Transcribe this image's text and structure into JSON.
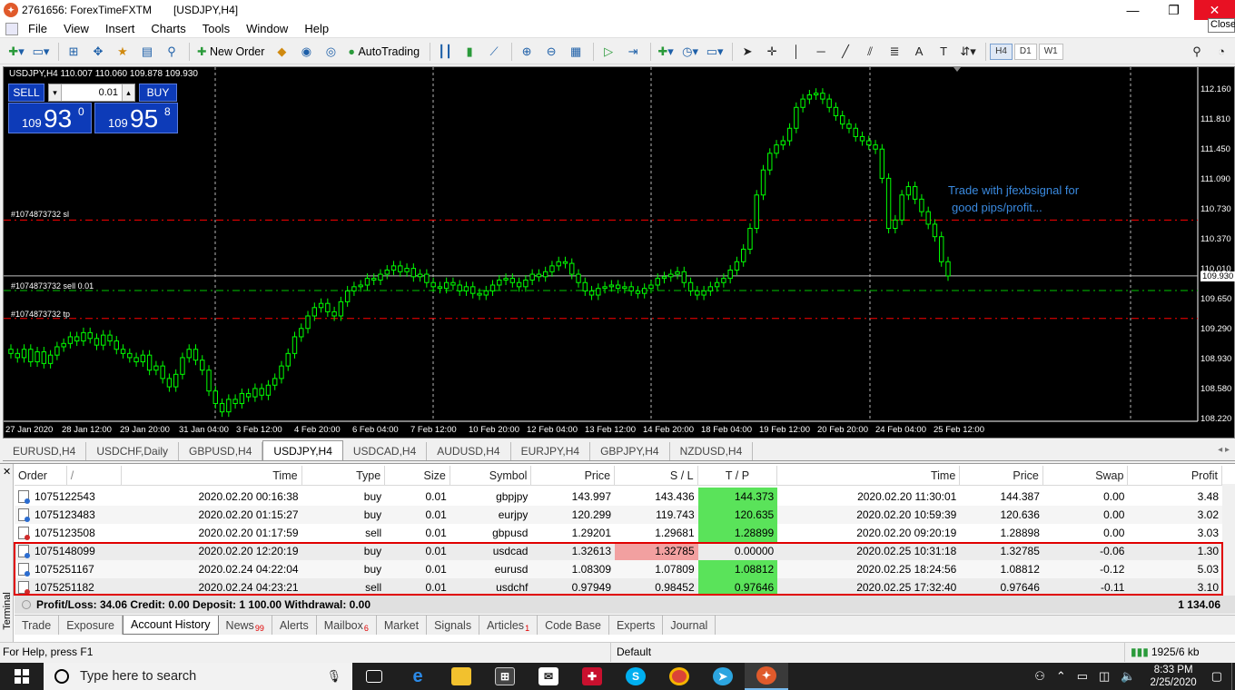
{
  "window": {
    "account": "2761656: ForexTimeFXTM",
    "doc": "[USDJPY,H4]"
  },
  "tooltip": "Close",
  "menu": [
    "File",
    "View",
    "Insert",
    "Charts",
    "Tools",
    "Window",
    "Help"
  ],
  "toolbar": {
    "new_order": "New Order",
    "autotrading": "AutoTrading",
    "timeframes": [
      "H4",
      "D1",
      "W1"
    ]
  },
  "chart": {
    "header": "USDJPY,H4  110.007 110.060 109.878 109.930",
    "oneclick": {
      "sell": "SELL",
      "buy": "BUY",
      "lot": "0.01",
      "sell_small": "109",
      "sell_big": "93",
      "sell_sup": "0",
      "buy_small": "109",
      "buy_big": "95",
      "buy_sup": "8"
    },
    "price_labels": [
      "112.160",
      "111.810",
      "111.450",
      "111.090",
      "110.730",
      "110.370",
      "110.010",
      "109.930",
      "109.650",
      "109.290",
      "108.930",
      "108.580",
      "108.220"
    ],
    "date_labels": [
      "27 Jan 2020",
      "28 Jan 12:00",
      "29 Jan 20:00",
      "31 Jan 04:00",
      "3 Feb 12:00",
      "4 Feb 20:00",
      "6 Feb 04:00",
      "7 Feb 12:00",
      "10 Feb 20:00",
      "12 Feb 04:00",
      "13 Feb 12:00",
      "14 Feb 20:00",
      "18 Feb 04:00",
      "19 Feb 12:00",
      "20 Feb 20:00",
      "24 Feb 04:00",
      "25 Feb 12:00"
    ],
    "levels": {
      "sl": "#1074873732 sl",
      "sell": "#1074873732 sell 0.01",
      "tp": "#1074873732 tp"
    },
    "annotation": [
      "Trade with jfexbsignal for",
      "good pips/profit..."
    ],
    "colors": {
      "bg": "#000000",
      "candle": "#00ff00",
      "sl_line": "#ff0000",
      "tp_line": "#ff0000",
      "entry_line": "#00c800",
      "grid": "#ffffff",
      "annotation": "#3a8ae0"
    }
  },
  "chart_tabs": [
    "EURUSD,H4",
    "USDCHF,Daily",
    "GBPUSD,H4",
    "USDJPY,H4",
    "USDCAD,H4",
    "AUDUSD,H4",
    "EURJPY,H4",
    "GBPJPY,H4",
    "NZDUSD,H4"
  ],
  "active_chart_tab": "USDJPY,H4",
  "terminal": {
    "side_label": "Terminal",
    "columns": [
      "Order",
      "/",
      "Time",
      "Type",
      "Size",
      "Symbol",
      "Price",
      "S / L",
      "T / P",
      "Time",
      "Price",
      "Swap",
      "Profit"
    ],
    "rows": [
      {
        "order": "1075122543",
        "open_time": "2020.02.20 00:16:38",
        "type": "buy",
        "size": "0.01",
        "symbol": "gbpjpy",
        "price": "143.997",
        "sl": "143.436",
        "tp": "144.373",
        "close_time": "2020.02.20 11:30:01",
        "close_price": "144.387",
        "swap": "0.00",
        "profit": "3.48",
        "tp_hl": "g",
        "sl_hl": ""
      },
      {
        "order": "1075123483",
        "open_time": "2020.02.20 01:15:27",
        "type": "buy",
        "size": "0.01",
        "symbol": "eurjpy",
        "price": "120.299",
        "sl": "119.743",
        "tp": "120.635",
        "close_time": "2020.02.20 10:59:39",
        "close_price": "120.636",
        "swap": "0.00",
        "profit": "3.02",
        "tp_hl": "g",
        "sl_hl": ""
      },
      {
        "order": "1075123508",
        "open_time": "2020.02.20 01:17:59",
        "type": "sell",
        "size": "0.01",
        "symbol": "gbpusd",
        "price": "1.29201",
        "sl": "1.29681",
        "tp": "1.28899",
        "close_time": "2020.02.20 09:20:19",
        "close_price": "1.28898",
        "swap": "0.00",
        "profit": "3.03",
        "tp_hl": "g",
        "sl_hl": ""
      },
      {
        "order": "1075148099",
        "open_time": "2020.02.20 12:20:19",
        "type": "buy",
        "size": "0.01",
        "symbol": "usdcad",
        "price": "1.32613",
        "sl": "1.32785",
        "tp": "0.00000",
        "close_time": "2020.02.25 10:31:18",
        "close_price": "1.32785",
        "swap": "-0.06",
        "profit": "1.30",
        "tp_hl": "",
        "sl_hl": "r"
      },
      {
        "order": "1075251167",
        "open_time": "2020.02.24 04:22:04",
        "type": "buy",
        "size": "0.01",
        "symbol": "eurusd",
        "price": "1.08309",
        "sl": "1.07809",
        "tp": "1.08812",
        "close_time": "2020.02.25 18:24:56",
        "close_price": "1.08812",
        "swap": "-0.12",
        "profit": "5.03",
        "tp_hl": "g",
        "sl_hl": ""
      },
      {
        "order": "1075251182",
        "open_time": "2020.02.24 04:23:21",
        "type": "sell",
        "size": "0.01",
        "symbol": "usdchf",
        "price": "0.97949",
        "sl": "0.98452",
        "tp": "0.97646",
        "close_time": "2020.02.25 17:32:40",
        "close_price": "0.97646",
        "swap": "-0.11",
        "profit": "3.10",
        "tp_hl": "g",
        "sl_hl": ""
      }
    ],
    "summary": "Profit/Loss: 34.06  Credit: 0.00  Deposit: 1 100.00  Withdrawal: 0.00",
    "total": "1 134.06",
    "tabs": [
      {
        "label": "Trade",
        "badge": ""
      },
      {
        "label": "Exposure",
        "badge": ""
      },
      {
        "label": "Account History",
        "badge": ""
      },
      {
        "label": "News",
        "badge": "99"
      },
      {
        "label": "Alerts",
        "badge": ""
      },
      {
        "label": "Mailbox",
        "badge": "6"
      },
      {
        "label": "Market",
        "badge": ""
      },
      {
        "label": "Signals",
        "badge": ""
      },
      {
        "label": "Articles",
        "badge": "1"
      },
      {
        "label": "Code Base",
        "badge": ""
      },
      {
        "label": "Experts",
        "badge": ""
      },
      {
        "label": "Journal",
        "badge": ""
      }
    ],
    "active_tab": "Account History"
  },
  "status": {
    "help": "For Help, press F1",
    "profile": "Default",
    "traffic": "1925/6 kb"
  },
  "taskbar": {
    "search_placeholder": "Type here to search",
    "time": "8:33 PM",
    "date": "2/25/2020"
  }
}
